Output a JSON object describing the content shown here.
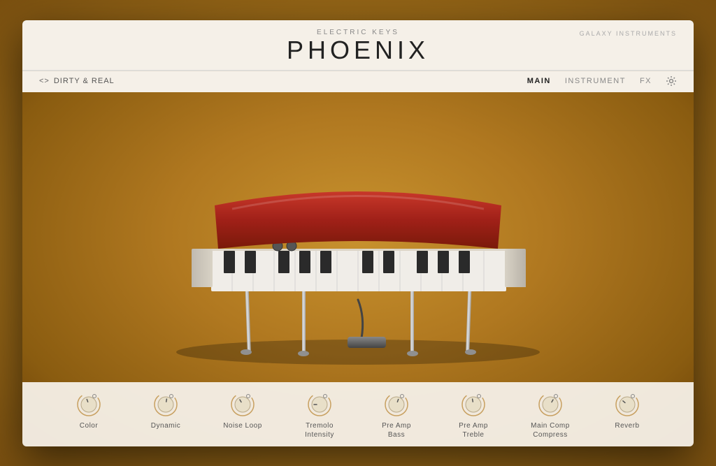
{
  "header": {
    "subtitle": "Electric Keys",
    "title": "PHOENIX",
    "galaxy_label": "Galaxy Instruments"
  },
  "nav": {
    "preset_arrows": "<>",
    "preset_name": "DIRTY & REAL",
    "links": [
      {
        "id": "main",
        "label": "MAIN",
        "active": true
      },
      {
        "id": "instrument",
        "label": "INSTRUMENT",
        "active": false
      },
      {
        "id": "fx",
        "label": "FX",
        "active": false
      }
    ]
  },
  "controls": [
    {
      "id": "color",
      "label": "Color",
      "rotation": -20
    },
    {
      "id": "dynamic",
      "label": "Dynamic",
      "rotation": 10
    },
    {
      "id": "noise-loop",
      "label": "Noise Loop",
      "rotation": -30
    },
    {
      "id": "tremolo-intensity",
      "label": "Tremolo\nIntensity",
      "rotation": -90
    },
    {
      "id": "pre-amp-bass",
      "label": "Pre Amp\nBass",
      "rotation": 20
    },
    {
      "id": "pre-amp-treble",
      "label": "Pre Amp\nTreble",
      "rotation": -10
    },
    {
      "id": "main-comp-compress",
      "label": "Main Comp\nCompress",
      "rotation": 30
    },
    {
      "id": "reverb",
      "label": "Reverb",
      "rotation": -50
    }
  ],
  "colors": {
    "header_bg": "#f5f0e8",
    "nav_bg": "#f5f0e8",
    "active_nav": "#222222",
    "inactive_nav": "#888888",
    "bg_gradient_center": "#c8922e",
    "bg_gradient_edge": "#6a4008",
    "controls_bg": "rgba(245,240,232,0.95)",
    "piano_lid": "#c0392b",
    "piano_body": "#d5cfc0"
  }
}
